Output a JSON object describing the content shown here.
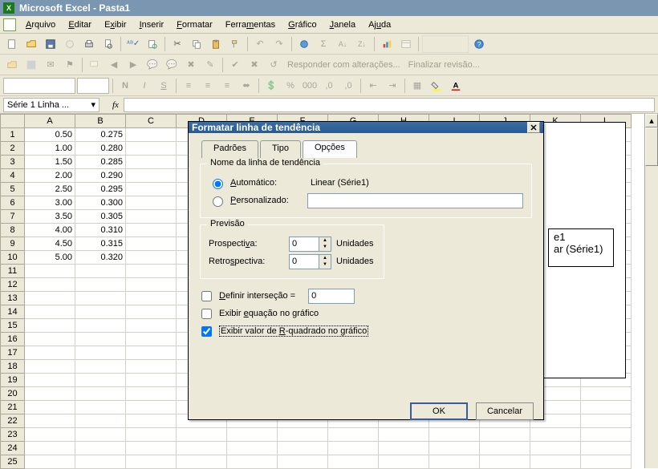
{
  "title": "Microsoft Excel - Pasta1",
  "menus": [
    "Arquivo",
    "Editar",
    "Exibir",
    "Inserir",
    "Formatar",
    "Ferramentas",
    "Gráfico",
    "Janela",
    "Ajuda"
  ],
  "menu_accel_index": [
    0,
    0,
    2,
    0,
    0,
    4,
    0,
    0,
    2
  ],
  "toolbar_text": {
    "responder": "Responder com alterações...",
    "finalizar": "Finalizar revisão..."
  },
  "namebox": "Série 1 Linha ...",
  "fx": "fx",
  "columns": [
    "A",
    "B",
    "C",
    "D",
    "E",
    "F",
    "G",
    "H",
    "I",
    "J",
    "K",
    "L"
  ],
  "rows": [
    {
      "n": 1,
      "a": "0.50",
      "b": "0.275"
    },
    {
      "n": 2,
      "a": "1.00",
      "b": "0.280"
    },
    {
      "n": 3,
      "a": "1.50",
      "b": "0.285"
    },
    {
      "n": 4,
      "a": "2.00",
      "b": "0.290"
    },
    {
      "n": 5,
      "a": "2.50",
      "b": "0.295"
    },
    {
      "n": 6,
      "a": "3.00",
      "b": "0.300"
    },
    {
      "n": 7,
      "a": "3.50",
      "b": "0.305"
    },
    {
      "n": 8,
      "a": "4.00",
      "b": "0.310"
    },
    {
      "n": 9,
      "a": "4.50",
      "b": "0.315"
    },
    {
      "n": 10,
      "a": "5.00",
      "b": "0.320"
    },
    {
      "n": 11,
      "a": "",
      "b": ""
    },
    {
      "n": 12,
      "a": "",
      "b": ""
    },
    {
      "n": 13,
      "a": "",
      "b": ""
    },
    {
      "n": 14,
      "a": "",
      "b": ""
    },
    {
      "n": 15,
      "a": "",
      "b": ""
    },
    {
      "n": 16,
      "a": "",
      "b": ""
    },
    {
      "n": 17,
      "a": "",
      "b": ""
    },
    {
      "n": 18,
      "a": "",
      "b": ""
    },
    {
      "n": 19,
      "a": "",
      "b": ""
    },
    {
      "n": 20,
      "a": "",
      "b": ""
    },
    {
      "n": 21,
      "a": "",
      "b": ""
    },
    {
      "n": 22,
      "a": "",
      "b": ""
    },
    {
      "n": 23,
      "a": "",
      "b": ""
    },
    {
      "n": 24,
      "a": "",
      "b": ""
    },
    {
      "n": 25,
      "a": "",
      "b": ""
    }
  ],
  "chart": {
    "legend1": "e1",
    "legend2": "ar (Série1)"
  },
  "dialog": {
    "title": "Formatar linha de tendência",
    "tabs": {
      "padroes": "Padrões",
      "tipo": "Tipo",
      "opcoes": "Opções"
    },
    "active_tab": "opcoes",
    "group_nome": "Nome da linha de tendência",
    "auto_label": "Automático:",
    "auto_value": "Linear (Série1)",
    "pers_label": "Personalizado:",
    "pers_value": "",
    "group_prev": "Previsão",
    "prosp_label": "Prospectiva:",
    "retro_label": "Retrospectiva:",
    "unidades": "Unidades",
    "prosp_val": "0",
    "retro_val": "0",
    "definir_label": "Definir interseção =",
    "definir_val": "0",
    "exibir_eq": "Exibir equação no gráfico",
    "exibir_r2": "Exibir valor de R-quadrado no gráfico",
    "checked": {
      "auto": true,
      "pers": false,
      "definir": false,
      "eq": false,
      "r2": true
    },
    "ok": "OK",
    "cancel": "Cancelar"
  }
}
